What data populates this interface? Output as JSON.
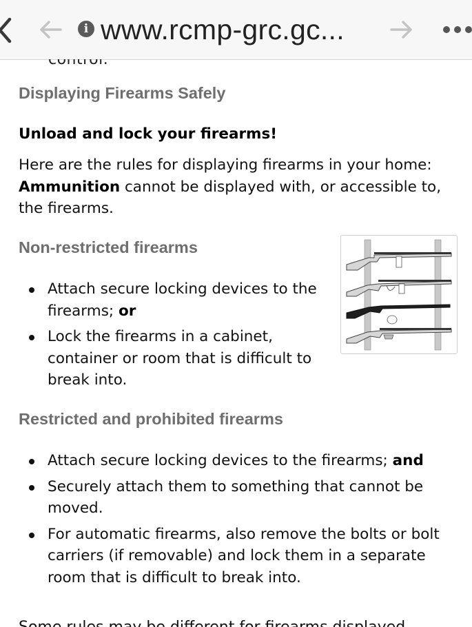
{
  "browser": {
    "url": "www.rcmp-grc.gc...",
    "icons": [
      "back-chevron-icon",
      "back-arrow-icon",
      "info-icon",
      "forward-arrow-icon",
      "more-dots-icon"
    ]
  },
  "content": {
    "cutoff_text": "control.",
    "section_title": "Displaying Firearms Safely",
    "subheading": "Unload and lock your firearms!",
    "intro": {
      "before": "Here are the rules for displaying firearms in your home: ",
      "bold": "Ammunition",
      "after": " cannot be displayed with, or accessible to, the firearms."
    },
    "non_restricted": {
      "title": "Non-restricted firearms",
      "items": [
        {
          "text": "Attach secure locking devices to the firearms; ",
          "bold": "or"
        },
        {
          "text": "Lock the firearms in a cabinet, container or room that is difficult to break into.",
          "bold": ""
        }
      ]
    },
    "restricted": {
      "title": "Restricted and prohibited firearms",
      "items": [
        {
          "text": "Attach secure locking devices to the firearms; ",
          "bold": "and"
        },
        {
          "text": "Securely attach them to something that cannot be moved.",
          "bold": ""
        },
        {
          "text": "For automatic firearms, also remove the bolts or bolt carriers (if removable) and lock them in a separate room that is difficult to break into.",
          "bold": ""
        }
      ]
    },
    "bottom_cutoff": "Some rules may be different for firearms displayed"
  },
  "colors": {
    "heading_grey": "#6e6e6e",
    "text": "#111111",
    "bar": "#f7f7f7"
  }
}
